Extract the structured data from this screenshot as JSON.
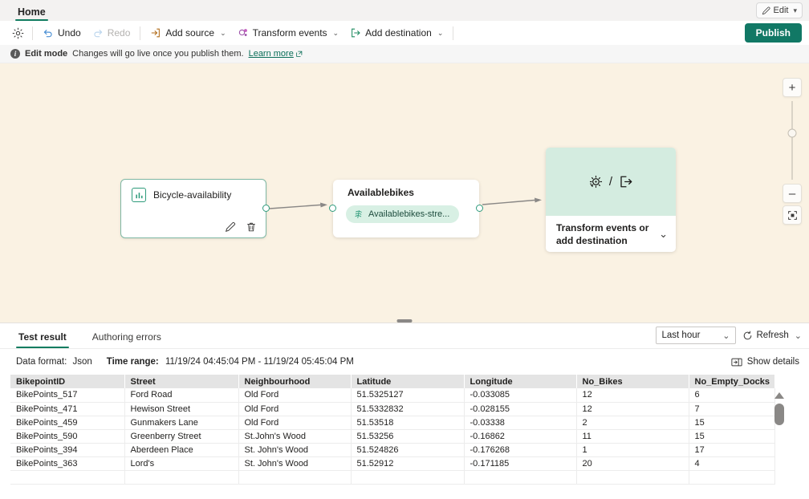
{
  "tabstrip": {
    "tabs": [
      {
        "label": "Home"
      }
    ],
    "edit_button": "Edit"
  },
  "toolbar": {
    "settings_icon": "gear-icon",
    "undo": "Undo",
    "redo": "Redo",
    "add_source": "Add source",
    "transform_events": "Transform events",
    "add_destination": "Add destination",
    "publish": "Publish"
  },
  "editbar": {
    "mode": "Edit mode",
    "message": "Changes will go live once you publish them.",
    "learn_more": "Learn more"
  },
  "canvas": {
    "source_node": {
      "title": "Bicycle-availability",
      "edit_icon": "pencil-icon",
      "delete_icon": "trash-icon"
    },
    "stream_node": {
      "title": "Availablebikes",
      "pill_label": "Availablebikes-stre..."
    },
    "destination_node": {
      "title": "Transform events or add destination",
      "transform_icon": "transform-icon",
      "destination_icon": "export-icon",
      "separator": "/"
    },
    "zoom_controls": {
      "zoom_in": "+",
      "zoom_out": "–",
      "fit_to_screen": "fit-icon"
    }
  },
  "bottom": {
    "tabs": [
      {
        "label": "Test result",
        "active": true
      },
      {
        "label": "Authoring errors",
        "active": false
      }
    ],
    "time_select": "Last hour",
    "refresh": "Refresh",
    "data_format_label": "Data format:",
    "data_format_value": "Json",
    "time_range_label": "Time range:",
    "time_range_value": "11/19/24 04:45:04 PM  -  11/19/24 05:45:04 PM",
    "show_details": "Show details"
  },
  "table": {
    "columns": [
      "BikepointID",
      "Street",
      "Neighbourhood",
      "Latitude",
      "Longitude",
      "No_Bikes",
      "No_Empty_Docks"
    ],
    "rows": [
      [
        "BikePoints_517",
        "Ford Road",
        "Old Ford",
        "51.5325127",
        "-0.033085",
        "12",
        "6"
      ],
      [
        "BikePoints_471",
        "Hewison Street",
        "Old Ford",
        "51.5332832",
        "-0.028155",
        "12",
        "7"
      ],
      [
        "BikePoints_459",
        "Gunmakers Lane",
        "Old Ford",
        "51.53518",
        "-0.03338",
        "2",
        "15"
      ],
      [
        "BikePoints_590",
        "Greenberry Street",
        "St.John's Wood",
        "51.53256",
        "-0.16862",
        "11",
        "15"
      ],
      [
        "BikePoints_394",
        "Aberdeen Place",
        "St. John's Wood",
        "51.524826",
        "-0.176268",
        "1",
        "17"
      ],
      [
        "BikePoints_363",
        "Lord's",
        "St. John's Wood",
        "51.52912",
        "-0.171185",
        "20",
        "4"
      ]
    ]
  },
  "colors": {
    "accent_green": "#107c60",
    "publish_green": "#117865",
    "canvas_bg": "#faf2e3",
    "node_border": "#7fb8a4",
    "pill_bg": "#d8f0e4",
    "dest_art_bg": "#d4ece0"
  }
}
